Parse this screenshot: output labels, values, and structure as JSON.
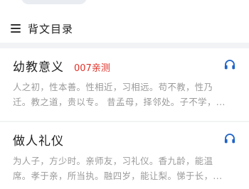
{
  "header": {
    "title": "背文目录",
    "menu_icon": "menu-icon"
  },
  "entries": [
    {
      "title": "幼教意义",
      "badge": "007亲测",
      "lines": [
        "人之初，性本善。性相近，习相远。苟不教，性乃",
        "迁。教之道，贵以专。 昔孟母，择邻处。子不学，..."
      ],
      "icon": "headphones-icon"
    },
    {
      "title": "做人礼仪",
      "badge": "",
      "lines": [
        "为人子，方少时。亲师友，习礼仪。香九龄，能温",
        "席。孝于亲，所当执。融四岁，能让梨。悌于长，..."
      ],
      "icon": "headphones-icon"
    }
  ],
  "colors": {
    "accent": "#1f63c7",
    "badge": "#e0332a",
    "text_muted": "#9a9a9a"
  }
}
